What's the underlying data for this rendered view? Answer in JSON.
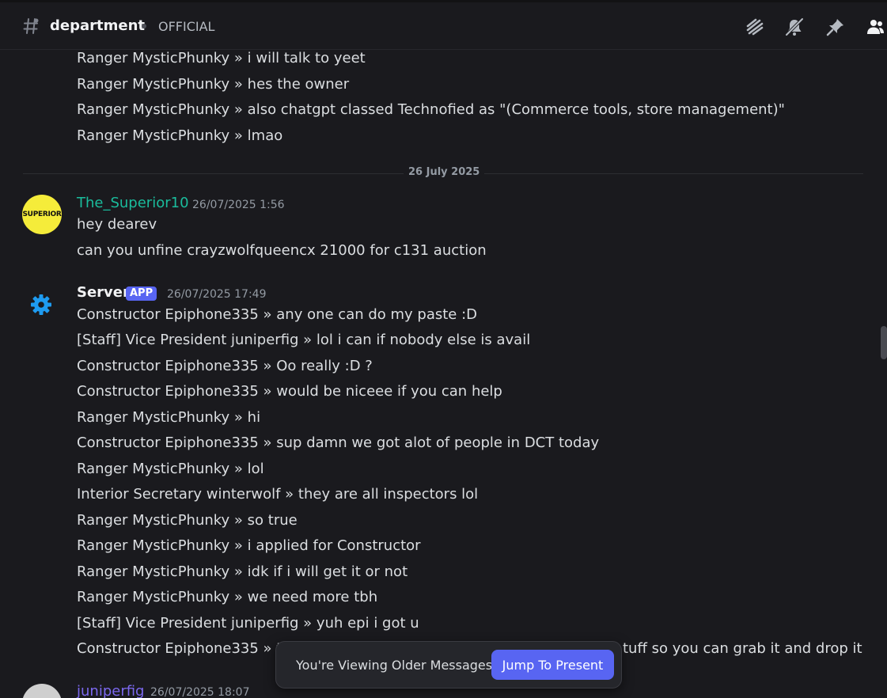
{
  "header": {
    "channel_name": "department",
    "channel_topic": "OFFICIAL",
    "icons": [
      "threads-icon",
      "mute-bell-icon",
      "pin-icon",
      "members-icon"
    ]
  },
  "colors": {
    "background": "#1a1a1e",
    "accent": "#5865f2",
    "superior_name": "#1abc9c",
    "juniperfig_name": "#7b68ee",
    "server_icon": "#1e9bf0"
  },
  "messages_top": [
    "Ranger MysticPhunky » i will talk to yeet",
    "Ranger MysticPhunky » hes the owner",
    "Ranger MysticPhunky » also chatgpt classed Technofied as \"(Commerce tools, store management)\"",
    "Ranger MysticPhunky » lmao"
  ],
  "date_divider": "26 July 2025",
  "superior": {
    "avatar_text": "SUPERIOR",
    "author": "The_Superior10",
    "timestamp": "26/07/2025 1:56",
    "lines": [
      "hey dearev",
      "can you unfine crayzwolfqueencx 21000 for c131 auction"
    ]
  },
  "server": {
    "author": "Server",
    "badge": "APP",
    "timestamp": "26/07/2025 17:49",
    "lines": [
      "Constructor Epiphone335 » any one can do my paste :D",
      "[Staff] Vice President juniperfig » lol i can if nobody else is avail",
      "Constructor Epiphone335 » Oo really :D ?",
      "Constructor Epiphone335 » would be niceee if you can help",
      "Ranger MysticPhunky » hi",
      "Constructor Epiphone335 » sup damn we got alot of people in DCT today",
      "Ranger MysticPhunky » lol",
      "Interior Secretary winterwolf » they are all inspectors lol",
      "Ranger MysticPhunky » so true",
      "Ranger MysticPhunky » i applied for Constructor",
      "Ranger MysticPhunky » idk if i will get it or not",
      "Ranger MysticPhunky » we need more tbh",
      "[Staff] Vice President juniperfig » yuh epi i got u"
    ],
    "partial_line_start": "Constructor Epiphone335 » ty",
    "partial_line_end": "tuff so you can grab it and drop it"
  },
  "juniperfig": {
    "author": "juniperfig",
    "timestamp": "26/07/2025 18:07"
  },
  "jump_bar": {
    "text": "You're Viewing Older Messages",
    "button": "Jump To Present"
  }
}
